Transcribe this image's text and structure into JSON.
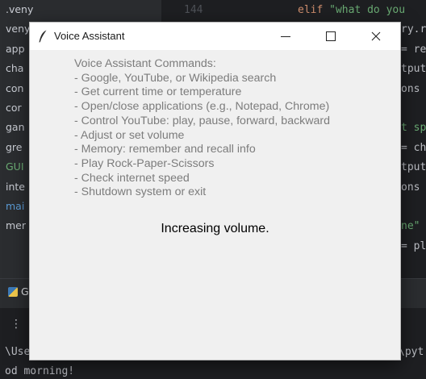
{
  "ide": {
    "project_items": [
      ".veny",
      "veny",
      "app",
      "cha",
      "con",
      "cor",
      "gan",
      "gre",
      "GUI",
      "inte",
      "mai",
      "mer"
    ],
    "project_item_colors": [
      "#c9ccd3",
      "#c9ccd3",
      "#c9ccd3",
      "#c9ccd3",
      "#c9ccd3",
      "#c9ccd3",
      "#c9ccd3",
      "#c9ccd3",
      "#6aab73",
      "#c9ccd3",
      "#5b9bd5",
      "#c9ccd3"
    ],
    "line_number": "144",
    "code_lines": [
      {
        "kw": "elif ",
        "str": "\"what do you",
        "plain": ""
      },
      {
        "kw": "",
        "str": "",
        "plain": "ry.r"
      },
      {
        "kw": "",
        "str": "",
        "plain": "= re"
      },
      {
        "kw": "",
        "str": "",
        "plain": "tput"
      },
      {
        "kw": "",
        "str": "",
        "plain": "ons"
      },
      {
        "kw": "",
        "str": "",
        "plain": ""
      },
      {
        "kw": "",
        "str": "t sp",
        "plain": ""
      },
      {
        "kw": "",
        "str": "",
        "plain": "= ch"
      },
      {
        "kw": "",
        "str": "",
        "plain": "tput"
      },
      {
        "kw": "",
        "str": "",
        "plain": "ons"
      },
      {
        "kw": "",
        "str": "",
        "plain": ""
      },
      {
        "kw": "",
        "str": "ne\"",
        "plain": ""
      },
      {
        "kw": "",
        "str": "",
        "plain": "= pl"
      }
    ],
    "run_tab_label": "G",
    "console_lines": [
      "\\Use",
      "od morning!"
    ],
    "console_right": "\\pyt"
  },
  "window": {
    "title": "Voice Assistant",
    "minimize_symbol": "—",
    "close_symbol": "✕",
    "commands": [
      "Voice Assistant Commands:",
      "- Google, YouTube, or Wikipedia search",
      "- Get current time or temperature",
      "- Open/close applications (e.g., Notepad, Chrome)",
      "- Control YouTube: play, pause, forward, backward",
      "- Adjust or set volume",
      "- Memory: remember and recall info",
      "- Play Rock-Paper-Scissors",
      "- Check internet speed",
      "- Shutdown system or exit"
    ],
    "status": "Increasing volume."
  }
}
